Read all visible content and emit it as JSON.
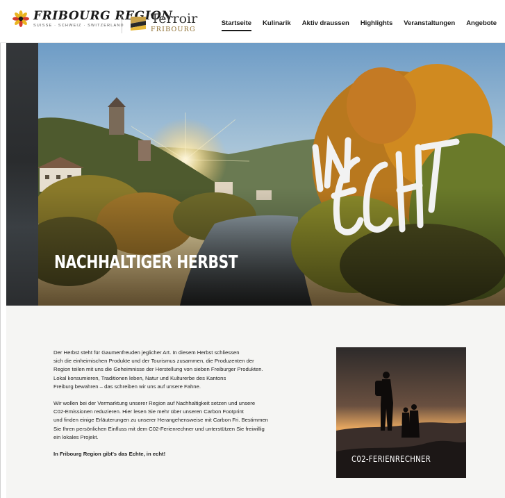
{
  "header": {
    "brand_name": "FRIBOURG REGION",
    "brand_sub": "SUISSE · SCHWEIZ · SWITZERLAND",
    "partner_name": "Terroir",
    "partner_sub": "FRIBOURG",
    "nav": [
      {
        "label": "Startseite",
        "active": true
      },
      {
        "label": "Kulinarik",
        "active": false
      },
      {
        "label": "Aktiv draussen",
        "active": false
      },
      {
        "label": "Highlights",
        "active": false
      },
      {
        "label": "Veranstaltungen",
        "active": false
      },
      {
        "label": "Angebote",
        "active": false
      }
    ]
  },
  "hero": {
    "title": "NACHHALTIGER HERBST",
    "script_line1": "IN",
    "script_line2": "ECHT"
  },
  "content": {
    "paragraph1_lines": [
      "Der Herbst steht für Gaumenfreuden jeglicher Art. In diesem Herbst schliessen",
      "sich die einheimischen Produkte und der Tourismus zusammen, die Produzenten der",
      "Region teilen mit uns die Geheimnisse der Herstellung von sieben Freiburger Produkten.",
      "Lokal konsumieren, Traditionen leben, Natur und Kulturerbe des Kantons",
      "Freiburg bewahren – das schreiben wir uns auf unsere Fahne."
    ],
    "paragraph2_lines": [
      "Wir wollen bei der Vermarktung unserer Region auf Nachhaltigkeit setzen und unsere",
      "C02-Emissionen reduzieren. Hier lesen Sie mehr über unseren Carbon Footprint",
      "und finden einige Erläuterungen zu unserer Herangehensweise mit Carbon Fri. Bestimmen",
      "Sie Ihren persönlichen Einfluss mit dem C02-Ferienrechner und unterstützen Sie freiwillig",
      "ein lokales Projekt."
    ],
    "tagline": "In Fribourg Region gibt's das Echte, in echt!",
    "card_label": "C02-FERIENRECHNER"
  },
  "colors": {
    "accent_text": "#1a1a1a",
    "content_bg": "#f5f5f3",
    "flower_yellow": "#e9b520",
    "flower_red": "#d33a2c"
  }
}
